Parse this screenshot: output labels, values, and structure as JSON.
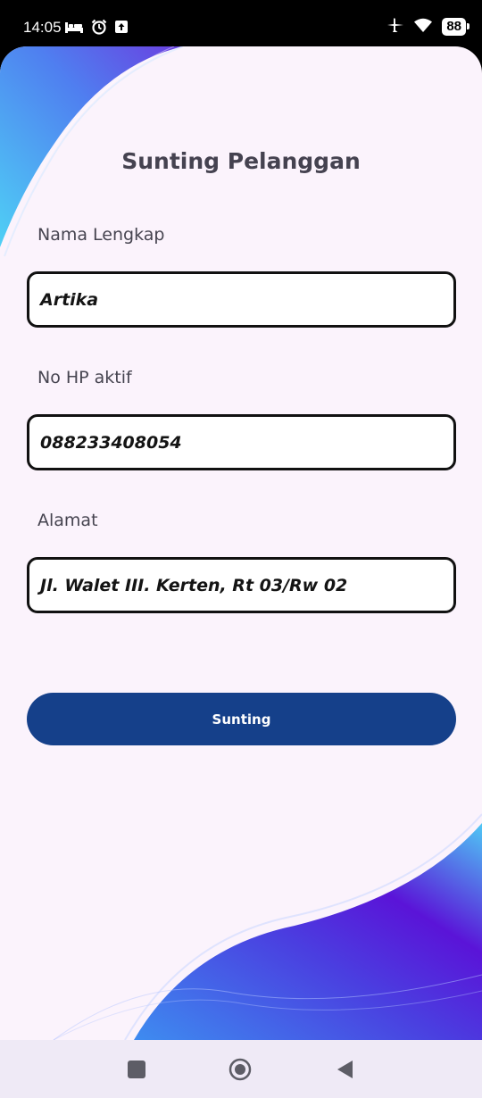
{
  "status_bar": {
    "time": "14:05",
    "battery": "88",
    "icons_left": [
      "bed-icon",
      "alarm-icon",
      "upload-icon"
    ],
    "icons_right": [
      "airplane-icon",
      "wifi-icon",
      "battery-icon"
    ]
  },
  "page": {
    "title": "Sunting Pelanggan"
  },
  "form": {
    "name_label": "Nama Lengkap",
    "name_value": "Artika",
    "phone_label": "No HP aktif",
    "phone_value": "088233408054",
    "address_label": "Alamat",
    "address_value": "Jl. Walet III. Kerten, Rt 03/Rw 02",
    "submit_label": "Sunting"
  },
  "colors": {
    "background": "#fbf3fc",
    "primary_button": "#15408a",
    "deco_purple": "#5a1ed9",
    "deco_cyan": "#4fd0f5"
  },
  "nav_bar": {
    "icons": [
      "recents-square-icon",
      "home-circle-icon",
      "back-triangle-icon"
    ]
  }
}
